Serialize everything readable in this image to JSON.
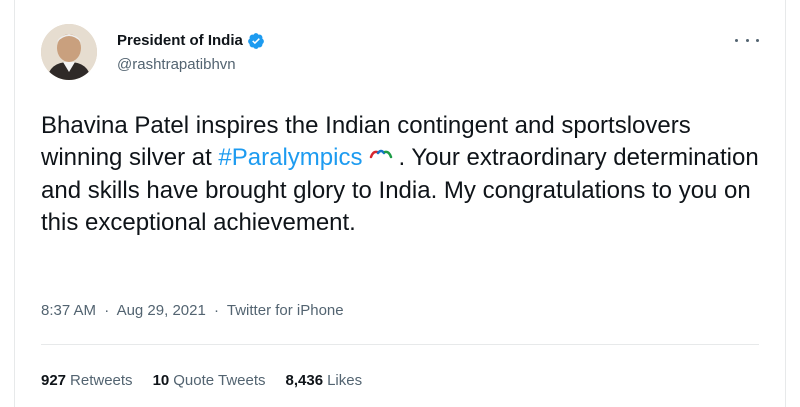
{
  "tweet": {
    "author_name": "President of India",
    "handle": "@rashtrapatibhvn",
    "text_before": "Bhavina Patel inspires the Indian contingent and sportslovers  winning silver at ",
    "hashtag": "#Paralympics",
    "text_after": ". Your extraordinary determination and skills have brought glory to India. My congratulations to you on this exceptional achievement.",
    "time": "8:37 AM",
    "date": "Aug 29, 2021",
    "source": "Twitter for iPhone",
    "separator": "·"
  },
  "stats": {
    "retweets_count": "927",
    "retweets_label": "Retweets",
    "quotes_count": "10",
    "quotes_label": "Quote Tweets",
    "likes_count": "8,436",
    "likes_label": "Likes"
  },
  "colors": {
    "link": "#1d9bf0",
    "secondary_text": "#536471",
    "divider": "#e7e9ea"
  },
  "icons": {
    "verified": "verified-badge-icon",
    "more": "more-options-icon",
    "emoji": "paralympics-agitos-icon"
  }
}
